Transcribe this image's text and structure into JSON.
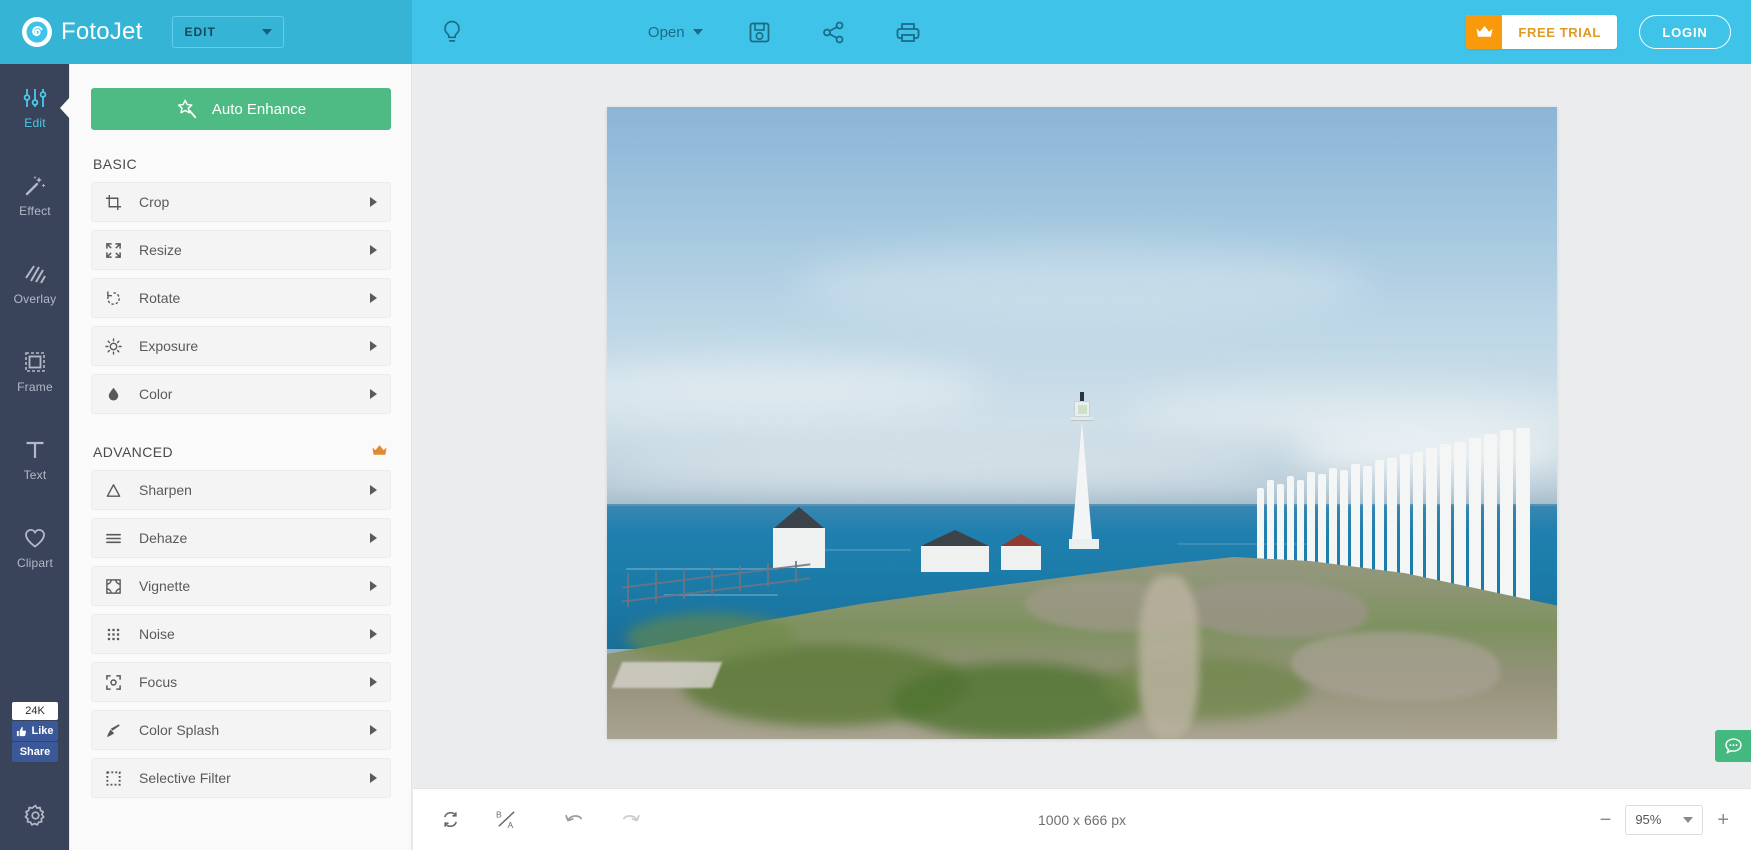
{
  "app": {
    "brand": "FotoJet",
    "logo_icon": "spiral-logo-icon",
    "mode_select": {
      "label": "EDIT",
      "icon": "chevron-down-icon"
    }
  },
  "topbar": {
    "tips_icon": "lightbulb-icon",
    "open": {
      "label": "Open",
      "icon": "caret-down-icon"
    },
    "save_icon": "floppy-save-icon",
    "share_icon": "share-nodes-icon",
    "print_icon": "printer-icon",
    "free_trial": {
      "label": "FREE TRIAL",
      "icon": "crown-icon"
    },
    "login": {
      "label": "LOGIN"
    },
    "accent_color": "#3fc3e8",
    "brand_zone_color": "#35b4d6",
    "trial_orange": "#f99a0c"
  },
  "rail": {
    "items": [
      {
        "label": "Edit",
        "icon": "sliders-icon",
        "active": true
      },
      {
        "label": "Effect",
        "icon": "magic-wand-icon",
        "active": false
      },
      {
        "label": "Overlay",
        "icon": "diagonal-stripes-icon",
        "active": false
      },
      {
        "label": "Frame",
        "icon": "frame-square-icon",
        "active": false
      },
      {
        "label": "Text",
        "icon": "text-t-icon",
        "active": false
      },
      {
        "label": "Clipart",
        "icon": "heart-icon",
        "active": false
      }
    ],
    "social": {
      "count": "24K",
      "like_label": "Like",
      "like_icon": "thumbs-up-icon",
      "share_label": "Share",
      "brand_color": "#3b5998"
    },
    "settings_icon": "gear-icon",
    "background": "#39435a",
    "active_color": "#4ec8e8"
  },
  "panel": {
    "auto_enhance": {
      "label": "Auto Enhance",
      "icon": "magic-star-icon",
      "color": "#4fbb84"
    },
    "sections": [
      {
        "title": "BASIC",
        "premium": false,
        "premium_icon": "",
        "items": [
          {
            "label": "Crop",
            "icon": "crop-icon",
            "arrow": "caret-right-icon"
          },
          {
            "label": "Resize",
            "icon": "resize-arrows-icon",
            "arrow": "caret-right-icon"
          },
          {
            "label": "Rotate",
            "icon": "rotate-ccw-icon",
            "arrow": "caret-right-icon"
          },
          {
            "label": "Exposure",
            "icon": "sun-icon",
            "arrow": "caret-right-icon"
          },
          {
            "label": "Color",
            "icon": "droplet-icon",
            "arrow": "caret-right-icon"
          }
        ]
      },
      {
        "title": "ADVANCED",
        "premium": true,
        "premium_icon": "crown-icon",
        "items": [
          {
            "label": "Sharpen",
            "icon": "triangle-icon",
            "arrow": "caret-right-icon"
          },
          {
            "label": "Dehaze",
            "icon": "horizontal-lines-icon",
            "arrow": "caret-right-icon"
          },
          {
            "label": "Vignette",
            "icon": "vignette-corners-icon",
            "arrow": "caret-right-icon"
          },
          {
            "label": "Noise",
            "icon": "dot-grid-icon",
            "arrow": "caret-right-icon"
          },
          {
            "label": "Focus",
            "icon": "focus-brackets-icon",
            "arrow": "caret-right-icon"
          },
          {
            "label": "Color Splash",
            "icon": "paint-brush-icon",
            "arrow": "caret-right-icon"
          },
          {
            "label": "Selective Filter",
            "icon": "dotted-square-icon",
            "arrow": "caret-right-icon"
          }
        ]
      }
    ]
  },
  "canvas": {
    "image_alt": "lighthouse-on-coastal-cliff-photo"
  },
  "bottombar": {
    "reset_icon": "reset-arrows-icon",
    "before_after_icon": "before-after-icon",
    "undo_icon": "undo-arrow-icon",
    "redo_icon": "redo-arrow-icon",
    "dimensions": "1000 x 666 px",
    "zoom_out_icon": "minus-icon",
    "zoom_value": "95%",
    "zoom_caret_icon": "caret-down-icon",
    "zoom_in_icon": "plus-icon"
  },
  "chat": {
    "icon": "chat-bubble-icon",
    "color": "#43b97f"
  }
}
